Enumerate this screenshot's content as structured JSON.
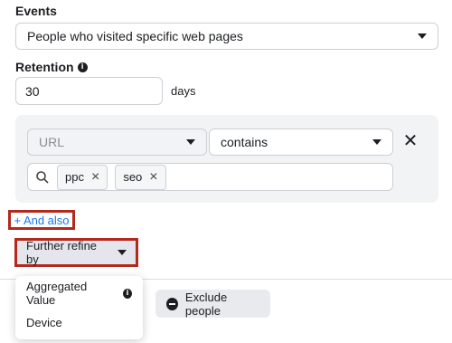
{
  "events": {
    "label": "Events",
    "selected": "People who visited specific web pages"
  },
  "retention": {
    "label": "Retention",
    "info_icon": "ⅰ",
    "value": "30",
    "unit": "days"
  },
  "rule": {
    "field": "URL",
    "operator": "contains",
    "keywords": [
      {
        "text": "ppc"
      },
      {
        "text": "seo"
      }
    ]
  },
  "and_also": {
    "label": "+ And also"
  },
  "refine": {
    "label": "Further refine by",
    "menu": [
      {
        "label": "Aggregated Value",
        "has_info": true
      },
      {
        "label": "Device",
        "has_info": false
      }
    ]
  },
  "exclude": {
    "label": "Exclude people"
  },
  "colors": {
    "link": "#1877f2",
    "highlight_border": "#b22a1e",
    "panel_bg": "#f2f3f5"
  }
}
